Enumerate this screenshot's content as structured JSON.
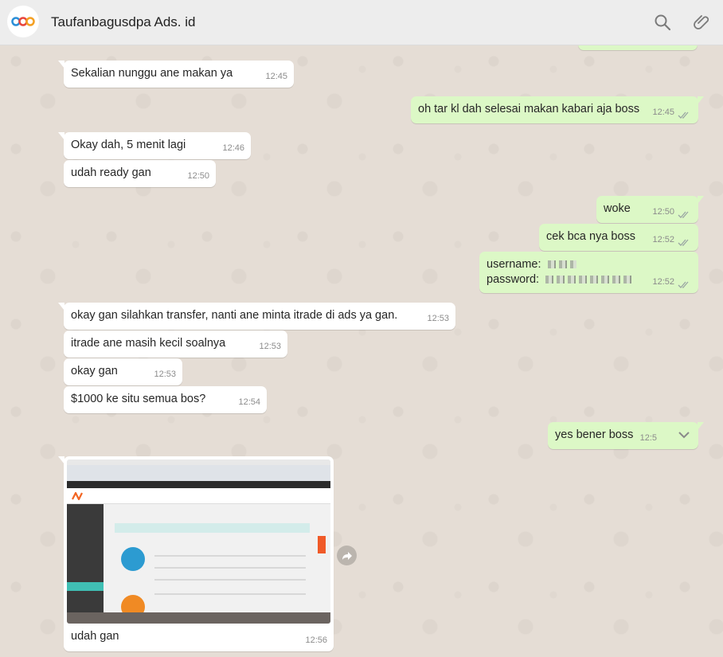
{
  "header": {
    "contact_name": "Taufanbagusdpa Ads. id",
    "search_icon": "search-icon",
    "attach_icon": "paperclip-icon"
  },
  "colors": {
    "incoming": "#ffffff",
    "outgoing": "#dcf8c6",
    "background": "#e5ddd5",
    "ticks": "#9aa6a3"
  },
  "messages": [
    {
      "dir": "in",
      "text": "Sekalian nunggu ane makan ya",
      "time": "12:45"
    },
    {
      "dir": "out",
      "text": "oh tar kl dah selesai makan kabari aja boss",
      "time": "12:45"
    },
    {
      "dir": "in",
      "text": "Okay dah, 5 menit lagi",
      "time": "12:46"
    },
    {
      "dir": "in",
      "text": "udah ready gan",
      "time": "12:50"
    },
    {
      "dir": "out",
      "text": "woke",
      "time": "12:50"
    },
    {
      "dir": "out",
      "text": "cek bca nya boss",
      "time": "12:52"
    },
    {
      "dir": "out",
      "line1": "username:",
      "line2": "password:",
      "time": "12:52"
    },
    {
      "dir": "in",
      "text": "okay gan silahkan transfer, nanti ane minta itrade di ads ya gan.",
      "time": "12:53"
    },
    {
      "dir": "in",
      "text": "itrade ane masih kecil soalnya",
      "time": "12:53"
    },
    {
      "dir": "in",
      "text": "okay gan",
      "time": "12:53"
    },
    {
      "dir": "in",
      "text": "$1000 ke situ semua bos?",
      "time": "12:54"
    },
    {
      "dir": "out",
      "text": "yes bener boss",
      "time": "12:5"
    },
    {
      "dir": "in",
      "text": "udah gan",
      "time": "12:56",
      "has_image": true
    }
  ]
}
